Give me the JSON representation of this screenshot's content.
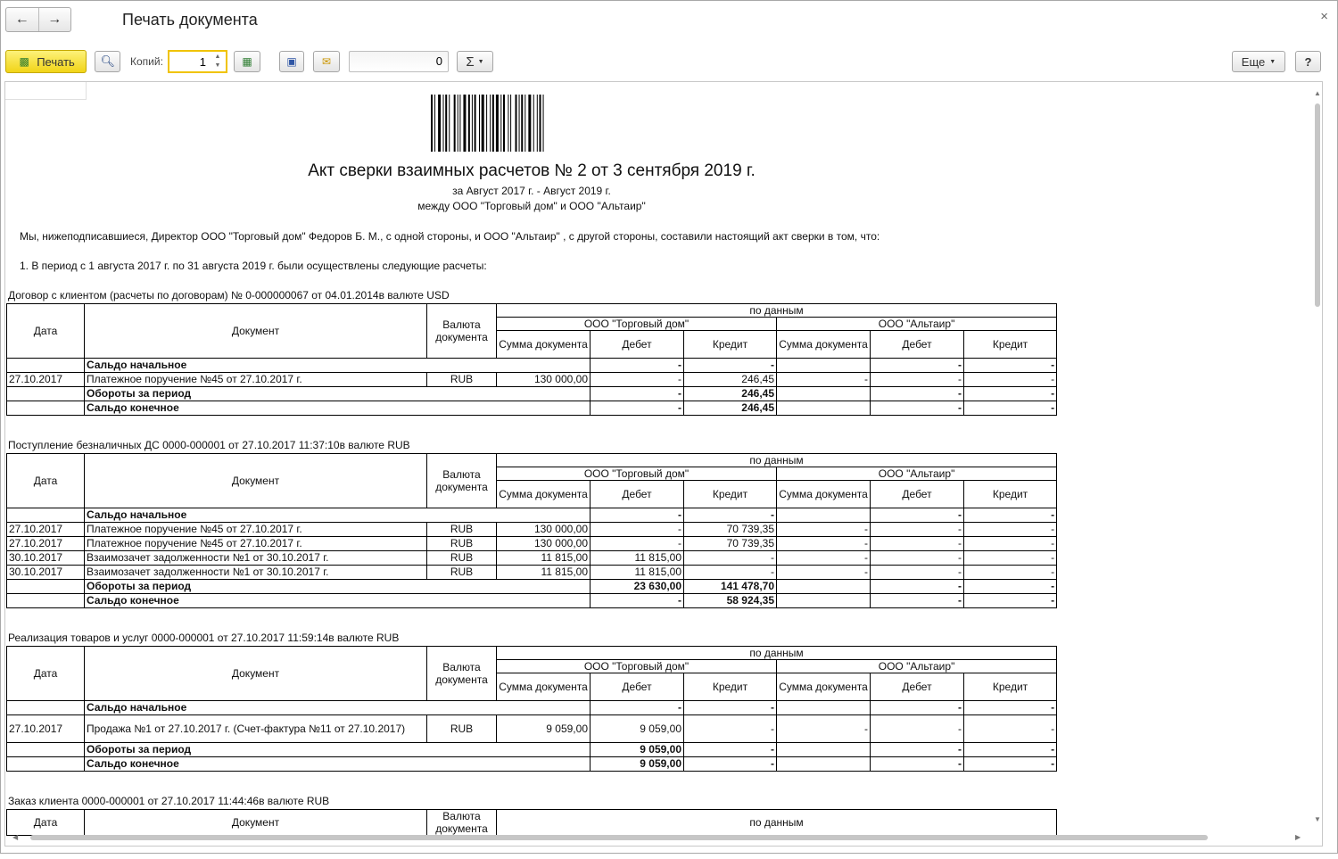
{
  "window": {
    "title": "Печать документа",
    "close_glyph": "×"
  },
  "toolbar": {
    "print_label": "Печать",
    "copies_label": "Копий:",
    "copies_value": "1",
    "sum_value": "0",
    "sigma_label": "Σ",
    "more_label": "Еще",
    "help_label": "?"
  },
  "document": {
    "title": "Акт сверки взаимных расчетов № 2 от 3 сентября 2019 г.",
    "period": "за Август 2017 г. - Август 2019 г.",
    "parties": "между ООО \"Торговый дом\" и ООО \"Альтаир\"",
    "intro": "Мы, нижеподписавшиеся, Директор ООО \"Торговый дом\" Федоров Б. М., с одной стороны, и  ООО \"Альтаир\" , с другой стороны, составили настоящий акт сверки в том, что:",
    "point1": "1. В период с 1 августа 2017 г. по 31 августа 2019 г. были осуществлены следующие расчеты:"
  },
  "header": {
    "date": "Дата",
    "document": "Документ",
    "currency": "Валюта документа",
    "by_data": "по данным",
    "party1": "ООО \"Торговый дом\"",
    "party2": "ООО \"Альтаир\"",
    "sum": "Сумма документа",
    "debit": "Дебет",
    "credit": "Кредит"
  },
  "labels": {
    "opening": "Сальдо начальное",
    "turnover": "Обороты за период",
    "closing": "Сальдо конечное"
  },
  "sections": [
    {
      "title": "Договор с клиентом (расчеты по договорам) № 0-000000067 от 04.01.2014в валюте USD",
      "opening": [
        "-",
        "-",
        "",
        "-",
        "-"
      ],
      "rows": [
        {
          "date": "27.10.2017",
          "doc": "Платежное поручение №45 от 27.10.2017 г.",
          "cur": "RUB",
          "sum1": "130 000,00",
          "d1": "-",
          "c1": "246,45",
          "sum2": "-",
          "d2": "-",
          "c2": "-"
        }
      ],
      "turnover": [
        "-",
        "246,45",
        "",
        "-",
        "-"
      ],
      "closing": [
        "-",
        "246,45",
        "",
        "-",
        "-"
      ]
    },
    {
      "title": "Поступление безналичных ДС 0000-000001 от 27.10.2017 11:37:10в валюте RUB",
      "opening": [
        "-",
        "-",
        "",
        "-",
        "-"
      ],
      "rows": [
        {
          "date": "27.10.2017",
          "doc": "Платежное поручение №45 от 27.10.2017 г.",
          "cur": "RUB",
          "sum1": "130 000,00",
          "d1": "-",
          "c1": "70 739,35",
          "sum2": "-",
          "d2": "-",
          "c2": "-"
        },
        {
          "date": "27.10.2017",
          "doc": "Платежное поручение №45 от 27.10.2017 г.",
          "cur": "RUB",
          "sum1": "130 000,00",
          "d1": "-",
          "c1": "70 739,35",
          "sum2": "-",
          "d2": "-",
          "c2": "-"
        },
        {
          "date": "30.10.2017",
          "doc": "Взаимозачет задолженности №1 от 30.10.2017 г.",
          "cur": "RUB",
          "sum1": "11 815,00",
          "d1": "11 815,00",
          "c1": "-",
          "sum2": "-",
          "d2": "-",
          "c2": "-"
        },
        {
          "date": "30.10.2017",
          "doc": "Взаимозачет задолженности №1 от 30.10.2017 г.",
          "cur": "RUB",
          "sum1": "11 815,00",
          "d1": "11 815,00",
          "c1": "-",
          "sum2": "-",
          "d2": "-",
          "c2": "-"
        }
      ],
      "turnover": [
        "23 630,00",
        "141 478,70",
        "",
        "-",
        "-"
      ],
      "closing": [
        "-",
        "58 924,35",
        "",
        "-",
        "-"
      ]
    },
    {
      "title": "Реализация товаров и услуг 0000-000001 от 27.10.2017 11:59:14в валюте RUB",
      "opening": [
        "-",
        "-",
        "",
        "-",
        "-"
      ],
      "rows": [
        {
          "date": "27.10.2017",
          "doc": "Продажа №1 от 27.10.2017 г. (Счет-фактура №11 от 27.10.2017)",
          "cur": "RUB",
          "sum1": "9 059,00",
          "d1": "9 059,00",
          "c1": "-",
          "sum2": "-",
          "d2": "-",
          "c2": "-",
          "tall": true
        }
      ],
      "turnover": [
        "9 059,00",
        "-",
        "",
        "-",
        "-"
      ],
      "closing": [
        "9 059,00",
        "-",
        "",
        "-",
        "-"
      ]
    },
    {
      "title": "Заказ клиента 0000-000001 от 27.10.2017 11:44:46в валюте RUB",
      "partial": true
    }
  ]
}
